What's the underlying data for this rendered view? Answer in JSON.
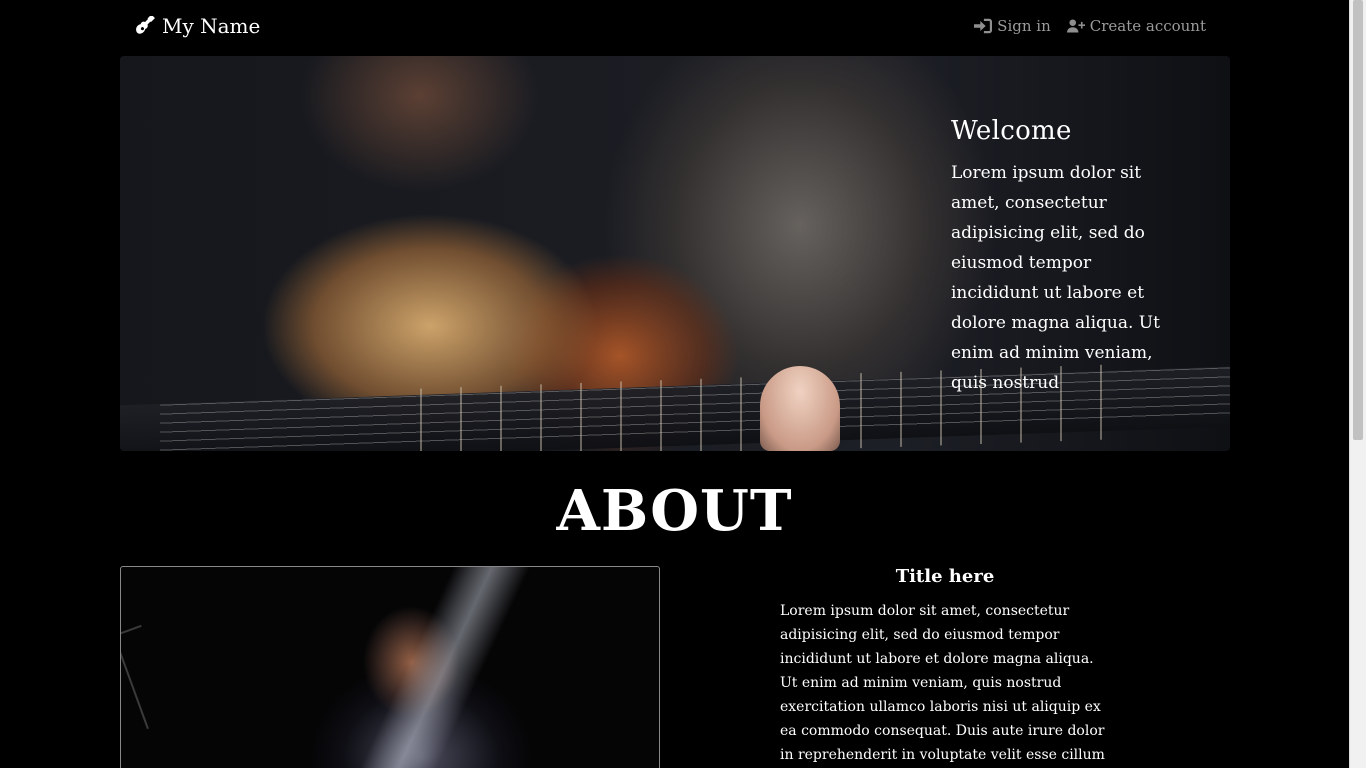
{
  "navbar": {
    "brand_icon": "guitar-icon",
    "brand_name": "My Name",
    "sign_in_icon": "sign-in-icon",
    "sign_in_label": "Sign in",
    "create_account_icon": "user-plus-icon",
    "create_account_label": "Create account"
  },
  "hero": {
    "title": "Welcome",
    "body": "Lorem ipsum dolor sit amet, consectetur adipisicing elit, sed do eiusmod tempor incididunt ut labore et dolore magna aliqua. Ut enim ad minim veniam, quis nostrud"
  },
  "about": {
    "heading": "ABOUT",
    "title": "Title here",
    "body": "Lorem ipsum dolor sit amet, consectetur adipisicing elit, sed do eiusmod tempor incididunt ut labore et dolore magna aliqua. Ut enim ad minim veniam, quis nostrud exercitation ullamco laboris nisi ut aliquip ex ea commodo consequat. Duis aute irure dolor in reprehenderit in voluptate velit esse cillum dolore eu fugiat nulla"
  },
  "colors": {
    "background": "#000000",
    "text": "#ffffff",
    "nav_link": "#9a9a9a"
  }
}
